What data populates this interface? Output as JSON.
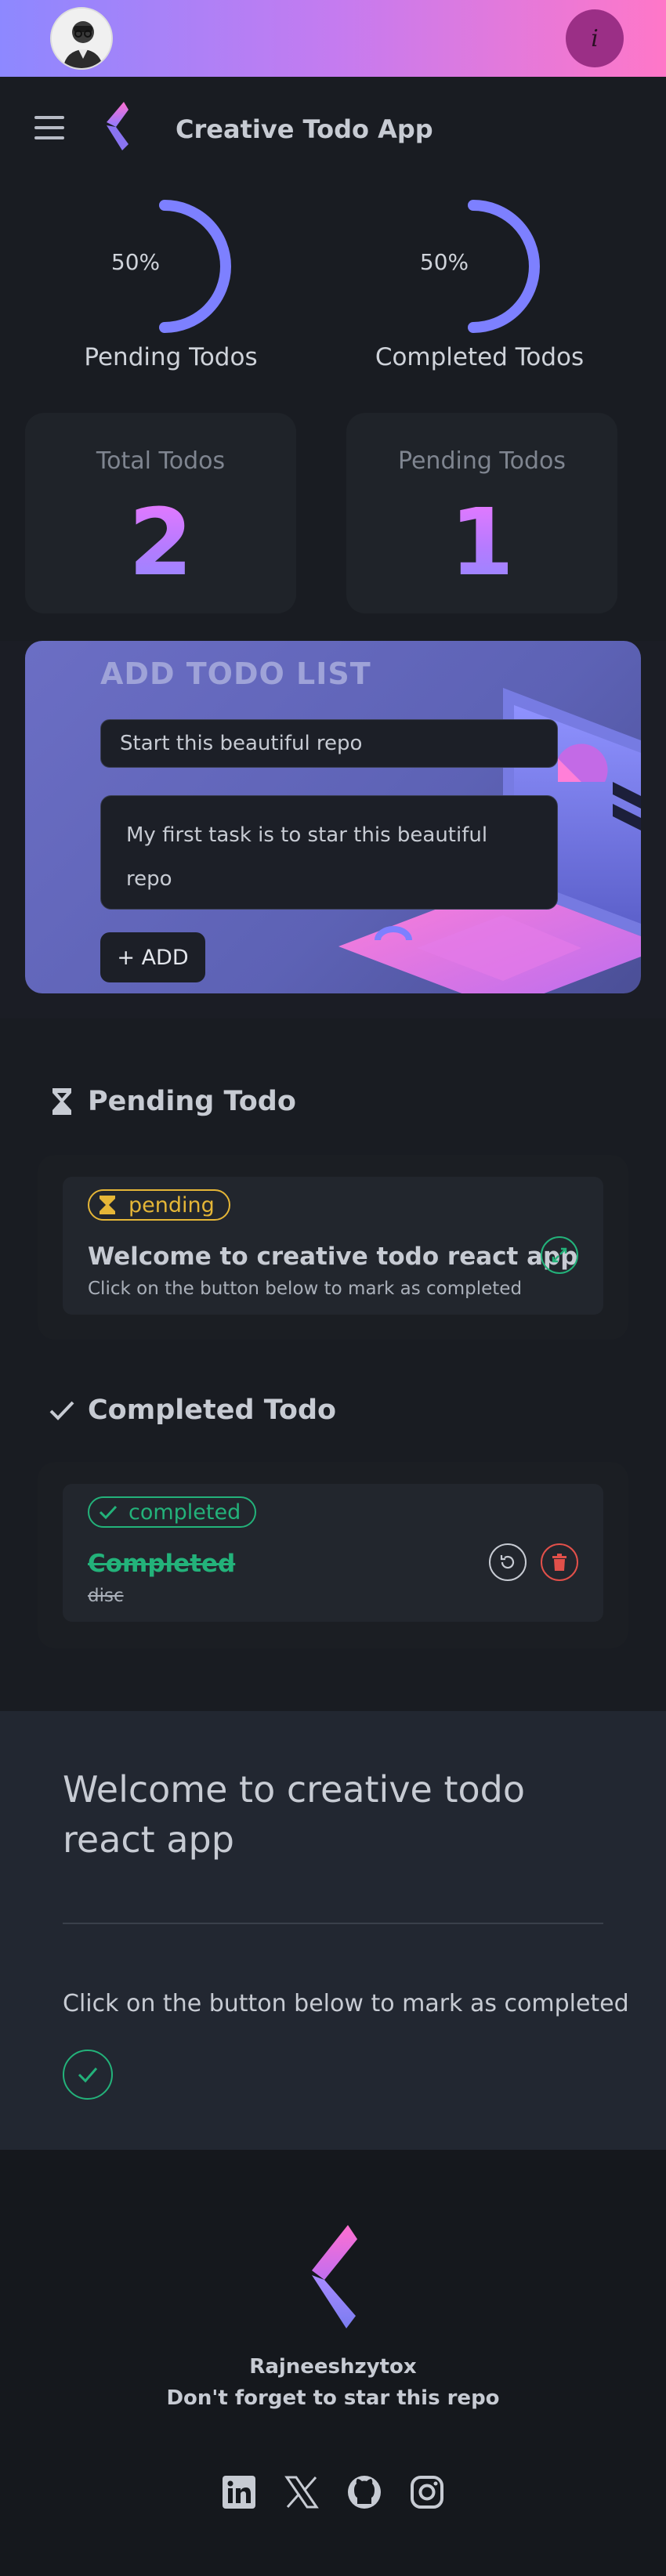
{
  "topbar": {
    "info_label": "i"
  },
  "header": {
    "app_title": "Creative Todo App"
  },
  "progress": [
    {
      "label": "Pending Todos",
      "value_text": "50%",
      "value": 0.5
    },
    {
      "label": "Completed Todos",
      "value_text": "50%",
      "value": 0.5
    }
  ],
  "stats": [
    {
      "title": "Total Todos",
      "value": "2"
    },
    {
      "title": "Pending Todos",
      "value": "1"
    }
  ],
  "add_form": {
    "title": "ADD TODO LIST",
    "title_value": "Start this beautiful repo",
    "description_value": "My first task is to star this beautiful repo",
    "add_label": "+ ADD"
  },
  "pending": {
    "heading": "Pending Todo",
    "items": [
      {
        "badge": "pending",
        "title": "Welcome to creative todo react app",
        "description": "Click on the button below to mark as completed"
      }
    ]
  },
  "completed": {
    "heading": "Completed Todo",
    "items": [
      {
        "badge": "completed",
        "title": "Completed",
        "description": "disc"
      }
    ]
  },
  "detail": {
    "title": "Welcome to creative todo react app",
    "description": "Click on the button below to mark as completed"
  },
  "footer": {
    "name": "Rajneeshzytox",
    "message": "Don't forget to star this repo",
    "socials": [
      "linkedin-icon",
      "x-icon",
      "github-icon",
      "instagram-icon"
    ]
  },
  "colors": {
    "accent_pink": "#ff77c8",
    "accent_purple": "#8d88ff",
    "pending": "#e5b637",
    "completed": "#23b27a",
    "delete": "#e2504a"
  }
}
